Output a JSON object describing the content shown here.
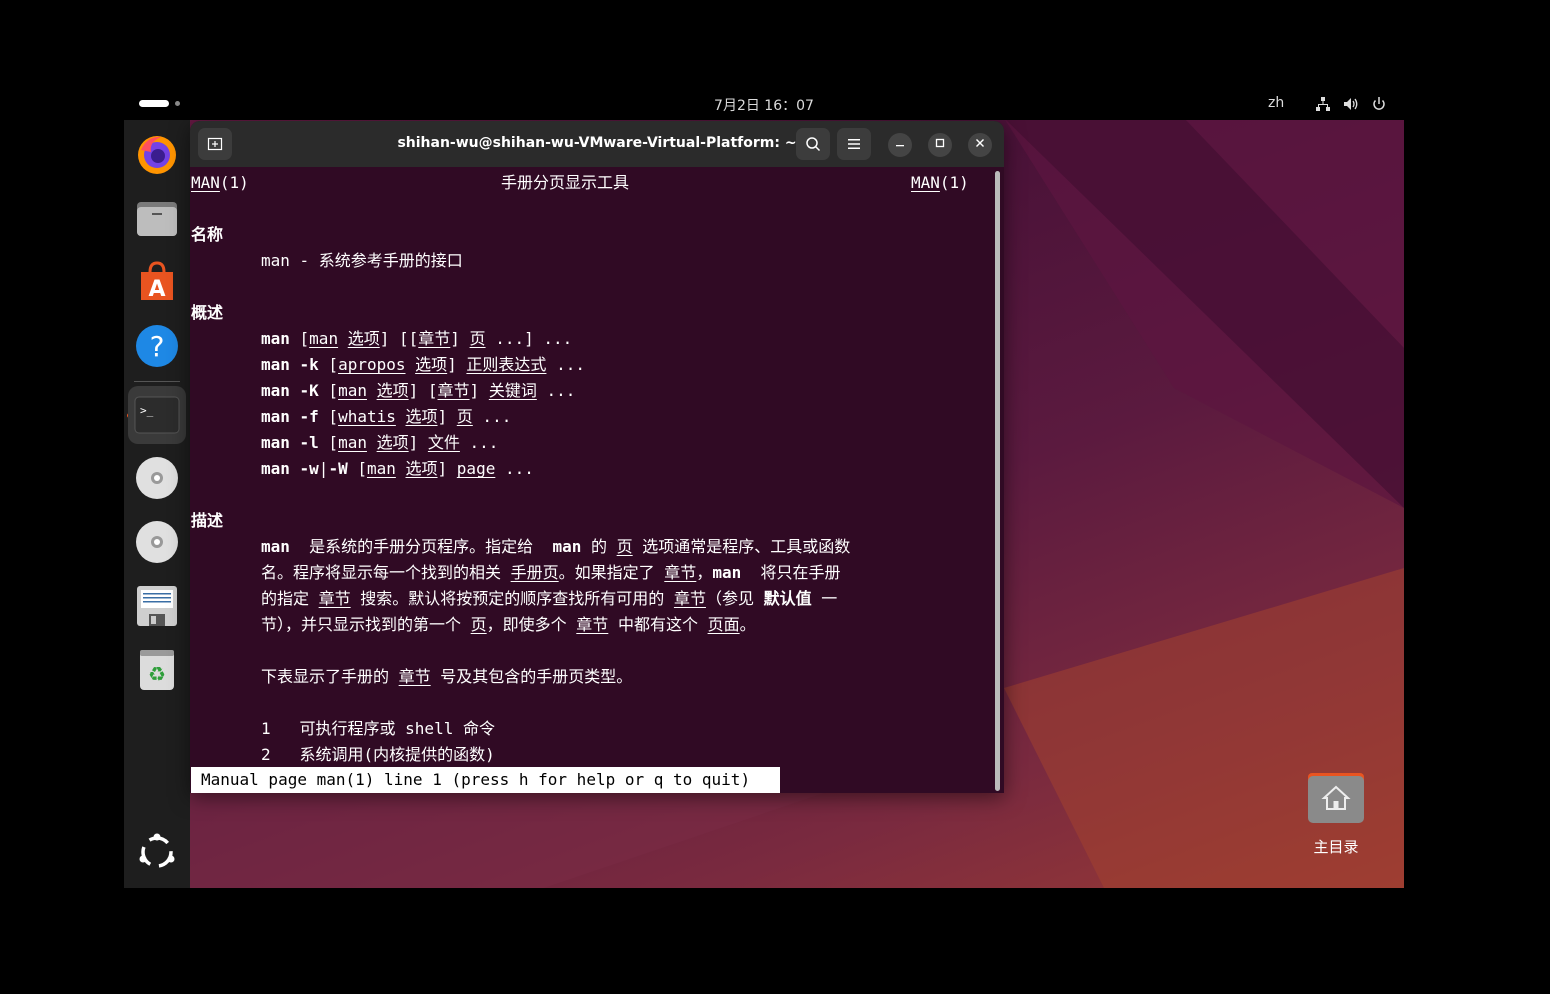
{
  "topbar": {
    "clock": "7月2日 16：07",
    "lang": "zh"
  },
  "dock": {
    "items": [
      {
        "name": "firefox-icon"
      },
      {
        "name": "files-icon"
      },
      {
        "name": "app-center-icon"
      },
      {
        "name": "help-icon"
      },
      {
        "name": "terminal-icon"
      },
      {
        "name": "disc-icon"
      },
      {
        "name": "disc-icon-2"
      },
      {
        "name": "text-editor-icon"
      },
      {
        "name": "trash-icon"
      },
      {
        "name": "show-apps-icon"
      }
    ]
  },
  "terminal": {
    "title": "shihan-wu@shihan-wu-VMware-Virtual-Platform: ~",
    "header_left": "MAN",
    "header_left_num": "(1)",
    "header_center": "手册分页显示工具",
    "header_right": "MAN",
    "header_right_num": "(1)",
    "sec_name": "名称",
    "name_line": "man - 系统参考手册的接口",
    "sec_synopsis": "概述",
    "sec_desc": "描述",
    "tail1": "下表显示了手册的 ",
    "tail1b": "章节",
    "tail1c": " 号及其包含的手册页类型。",
    "list1": "1   可执行程序或 shell 命令",
    "list2": "2   系统调用(内核提供的函数)",
    "status": "Manual page man(1) line 1 (press h for help or q to quit)"
  },
  "synopsis": {
    "l1": [
      "man",
      " [",
      "man",
      " ",
      "选项",
      "] [[",
      "章节",
      "] ",
      "页",
      " ...] ..."
    ],
    "l2": [
      "man -k",
      " [",
      "apropos",
      " ",
      "选项",
      "] ",
      "正则表达式",
      " ..."
    ],
    "l3": [
      "man -K",
      " [",
      "man",
      " ",
      "选项",
      "] [",
      "章节",
      "] ",
      "关键词",
      " ..."
    ],
    "l4": [
      "man -f",
      " [",
      "whatis",
      " ",
      "选项",
      "] ",
      "页",
      " ..."
    ],
    "l5": [
      "man -l",
      " [",
      "man",
      " ",
      "选项",
      "] ",
      "文件",
      " ..."
    ],
    "l6": [
      "man -w",
      "|",
      "-W",
      " [",
      "man",
      " ",
      "选项",
      "] ",
      "page",
      " ..."
    ]
  },
  "desc": {
    "d1": [
      "man",
      "  是系统的手册分页程序。指定给  ",
      "man",
      " 的 ",
      "页",
      " 选项通常是程序、工具或函数"
    ],
    "d2": [
      "名。程序将显示每一个找到的相关 ",
      "手册页",
      "。如果指定了 ",
      "章节",
      "，",
      "man",
      "  将只在手册"
    ],
    "d3": [
      "的指定 ",
      "章节",
      " 搜索。默认将按预定的顺序查找所有可用的 ",
      "章节",
      "（参见 ",
      "默认值",
      " 一"
    ],
    "d4": [
      "节），并只显示找到的第一个 ",
      "页",
      "，即使多个 ",
      "章节",
      " 中都有这个 ",
      "页面",
      "。"
    ]
  },
  "desktop": {
    "home_label": "主目录"
  }
}
